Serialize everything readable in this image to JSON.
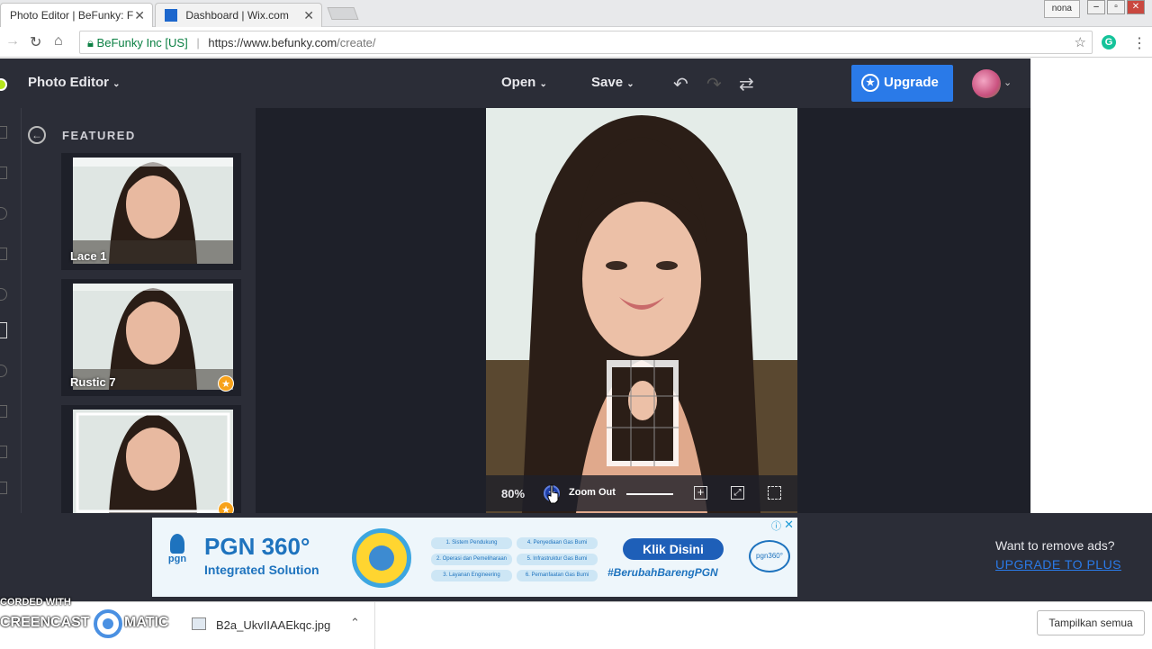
{
  "browser": {
    "tabs": [
      {
        "title": "Photo Editor | BeFunky: F",
        "active": true
      },
      {
        "title": "Dashboard | Wix.com",
        "active": false
      }
    ],
    "profile_name": "nona",
    "secure_label": "BeFunky Inc [US]",
    "url_host": "https://www.befunky.com",
    "url_path": "/create/"
  },
  "app": {
    "title": "Photo Editor",
    "open_label": "Open",
    "save_label": "Save",
    "upgrade_label": "Upgrade"
  },
  "panel": {
    "heading": "FEATURED",
    "items": [
      {
        "label": "Lace 1",
        "premium": false
      },
      {
        "label": "Rustic 7",
        "premium": true
      },
      {
        "label": "",
        "premium": true
      }
    ]
  },
  "zoom": {
    "percent": "80%",
    "tooltip": "Zoom Out"
  },
  "ad": {
    "brand": "pgn",
    "title": "PGN 360°",
    "subtitle": "Integrated Solution",
    "services": [
      "1. Sistem Pendukung",
      "2. Operasi dan Pemeliharaan",
      "3. Layanan Engineering",
      "4. Penyediaan Gas Bumi",
      "5. Infrastruktur Gas Bumi",
      "6. Pemanfaatan Gas Bumi"
    ],
    "cta": "Klik Disini",
    "hashtag": "#BerubahBarengPGN",
    "badge": "pgn360°",
    "remove_text": "Want to remove ads?",
    "upgrade_plus": "UPGRADE TO PLUS"
  },
  "watermark": {
    "line1": "CORDED WITH",
    "line2": "CREENCAST",
    "line3": "MATIC"
  },
  "download": {
    "filename": "B2a_UkvIIAAEkqc.jpg",
    "show_all": "Tampilkan semua"
  },
  "colors": {
    "accent": "#2a7ae8",
    "app_bg": "#1e2029",
    "toolbar_bg": "#2b2d37",
    "premium_badge": "#f7a21b"
  }
}
